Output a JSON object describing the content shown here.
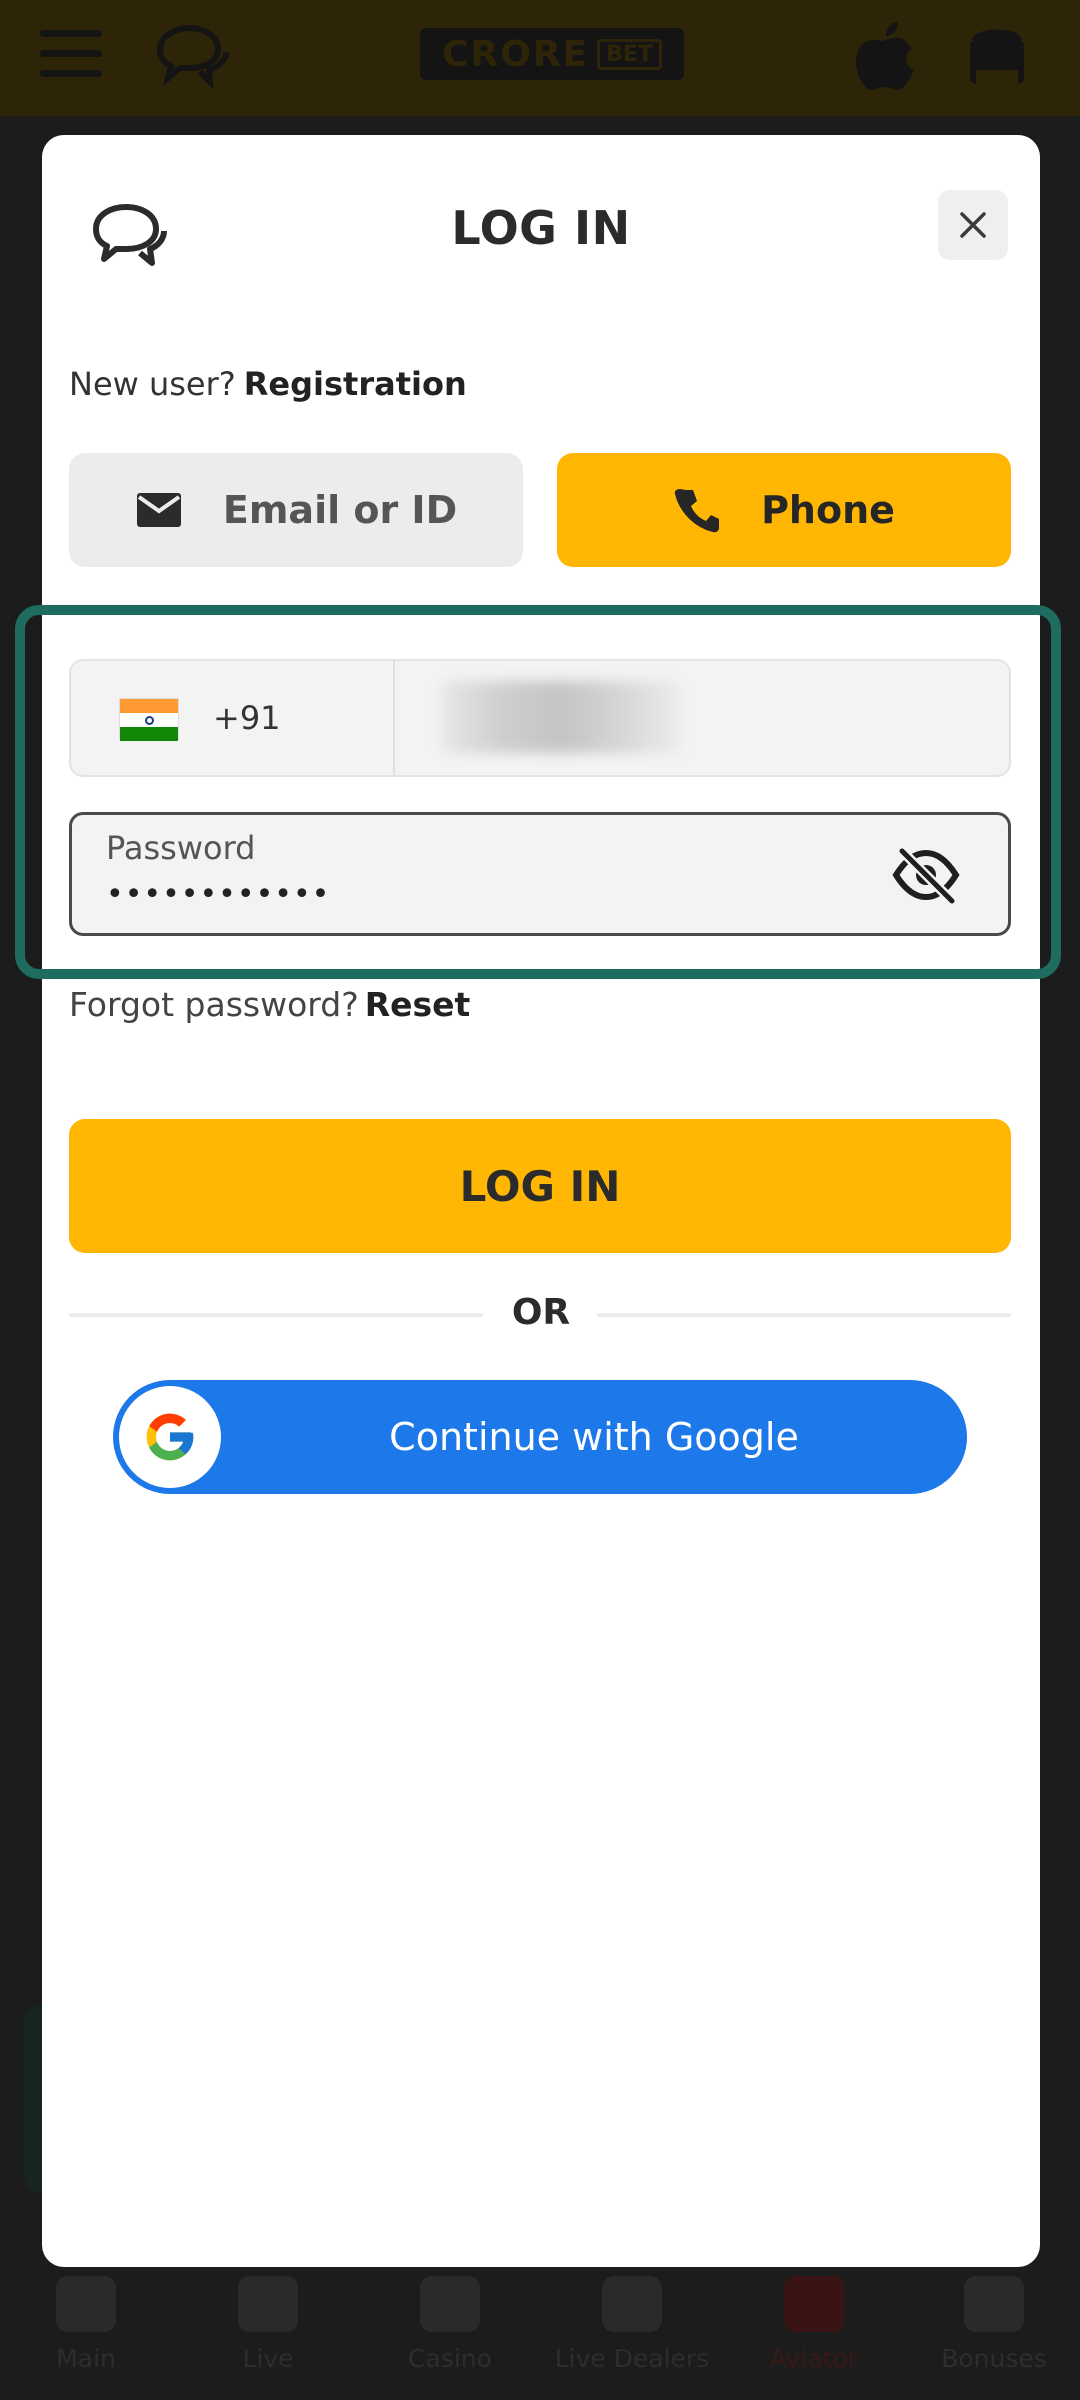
{
  "app": {
    "logo_word": "CRORE",
    "logo_tag": "BET"
  },
  "bottom_nav": [
    {
      "label": "Main",
      "icon": "grid-icon"
    },
    {
      "label": "Live",
      "icon": "stadium-icon"
    },
    {
      "label": "Casino",
      "icon": "chips-icon"
    },
    {
      "label": "Live Dealers",
      "icon": "dealer-icon"
    },
    {
      "label": "Aviator",
      "icon": "plane-icon"
    },
    {
      "label": "Bonuses",
      "icon": "gift-icon"
    }
  ],
  "modal": {
    "title": "LOG IN",
    "new_user_text": "New user?",
    "registration_link": "Registration",
    "tabs": {
      "email_label": "Email or ID",
      "phone_label": "Phone",
      "active": "Phone"
    },
    "phone": {
      "country_code": "+91",
      "country": "India"
    },
    "password": {
      "label": "Password",
      "value": "••••••••••••"
    },
    "forgot_text": "Forgot password?",
    "reset_link": "Reset",
    "login_button": "LOG IN",
    "or_text": "OR",
    "google_button": "Continue with Google"
  },
  "colors": {
    "accent": "#ffb703",
    "google_blue": "#1d78ea",
    "highlight_border": "#1e6b60"
  }
}
